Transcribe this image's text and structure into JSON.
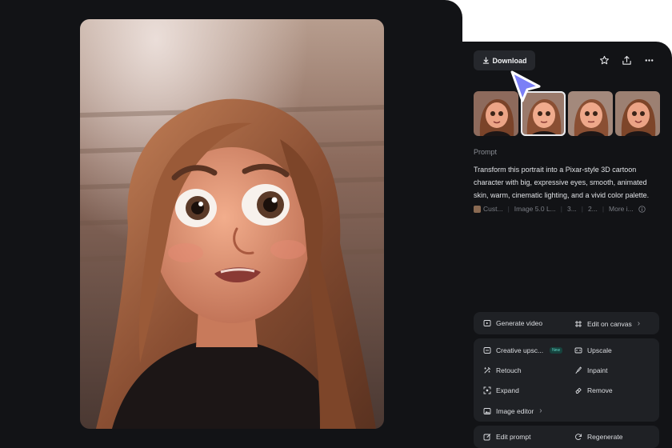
{
  "toolbar": {
    "download_label": "Download",
    "icons": [
      "download-icon",
      "star-icon",
      "share-icon",
      "more-icon"
    ]
  },
  "thumbnails": {
    "count": 4,
    "selected_index": 1
  },
  "prompt": {
    "label": "Prompt",
    "text": "Transform this portrait into a Pixar-style 3D cartoon character with big, expressive eyes, smooth, animated skin, warm, cinematic lighting, and a vivid color palette."
  },
  "meta": {
    "items": [
      "Cust...",
      "Image 5.0 L...",
      "3...",
      "2...",
      "More i..."
    ],
    "info_icon": "info-icon"
  },
  "actions": {
    "generate_video": "Generate video",
    "edit_on_canvas": "Edit on canvas",
    "creative_upscale": "Creative upsc...",
    "new_badge": "New",
    "upscale": "Upscale",
    "retouch": "Retouch",
    "inpaint": "Inpaint",
    "expand": "Expand",
    "remove": "Remove",
    "image_editor": "Image editor",
    "edit_prompt": "Edit prompt",
    "regenerate": "Regenerate"
  },
  "colors": {
    "background": "#121316",
    "card": "#1f2125",
    "accent_cursor": "#7b7ff6",
    "new_badge": "#5fd3c4"
  }
}
